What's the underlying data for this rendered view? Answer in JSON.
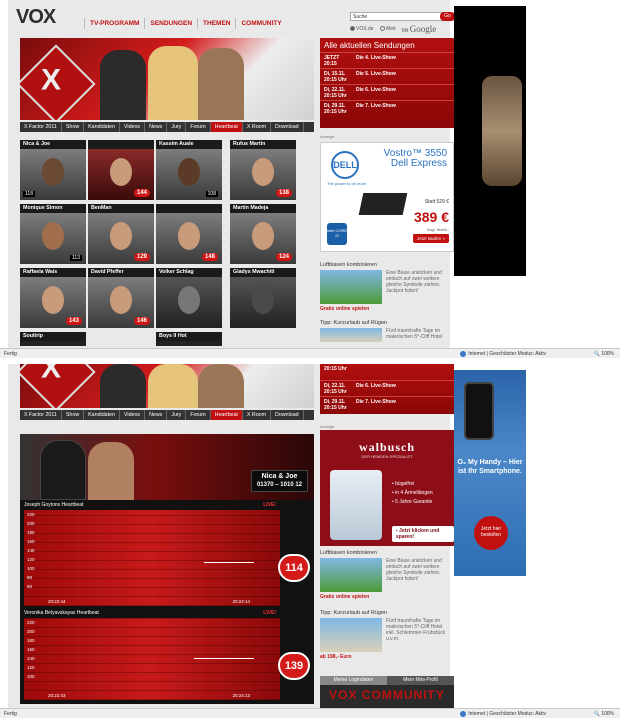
{
  "shot1": {
    "logo": "VOX",
    "mainnav": [
      "TV-PROGRAMM",
      "SENDUNGEN",
      "THEMEN",
      "COMMUNITY"
    ],
    "search": {
      "value": "Suche",
      "button": "Go",
      "opt1": "VOX.de",
      "opt2": "Web",
      "mit": "Mit",
      "google": "Google"
    },
    "subnav": [
      "X Factor 2011",
      "Show",
      "Kandidaten",
      "Videos",
      "News",
      "Jury",
      "Forum",
      "Heartbeat",
      "X Room",
      "Download"
    ],
    "hero_logo": "X",
    "sendungen": {
      "title": "Alle aktuellen Sendungen",
      "rows": [
        {
          "d": "JETZT",
          "t": "20:15",
          "s": "Die 4. Live-Show"
        },
        {
          "d": "Di, 15.11.",
          "t": "20:15 Uhr",
          "s": "Die 5. Live-Show"
        },
        {
          "d": "Di, 22.11.",
          "t": "20:15 Uhr",
          "s": "Die 6. Live-Show"
        },
        {
          "d": "Di, 29.11.",
          "t": "20:15 Uhr",
          "s": "Die 7. Live-Show"
        }
      ]
    },
    "cards": [
      {
        "name": "Nica & Joe",
        "count": "144",
        "small": "118"
      },
      {
        "name": "Kassim Auale",
        "count": "",
        "small": "108"
      },
      {
        "name": "Rufus Martin",
        "count": "138",
        "small": ""
      },
      {
        "name": "Monique Simon",
        "count": "",
        "small": "113"
      },
      {
        "name": "BenMan",
        "count": "129",
        "small": ""
      },
      {
        "name": "",
        "count": "148",
        "small": ""
      },
      {
        "name": "Martin Madeja",
        "count": "124",
        "small": ""
      },
      {
        "name": "Raffaela Wais",
        "count": "143",
        "small": ""
      },
      {
        "name": "David Pfeffer",
        "count": "146",
        "small": ""
      },
      {
        "name": "Volker Schlag",
        "count": "",
        "small": ""
      },
      {
        "name": "Gladys Mwachiti",
        "count": "",
        "small": ""
      },
      {
        "name": "Soultrip",
        "count": "",
        "small": ""
      },
      {
        "name": "Boys II Hot",
        "count": "",
        "small": ""
      }
    ],
    "dell_ad": {
      "label": "Anzeige",
      "brand": "DELL",
      "tagline": "The power to do more",
      "model": "Vostro™ 3550",
      "edition": "Dell Express",
      "statt": "Statt 529 €",
      "price": "389 €",
      "vat": "Zzgl. MwSt., kostenloser Versand",
      "button": "Jetzt kaufen »",
      "intel": "intel CORE i3"
    },
    "promo1": {
      "title": "Luftblasen kombinieren",
      "text": "Eine Blase anklicken und einfach auf zwei weitere gleiche Symbole ziehen. Jackpot holen!",
      "link": "Gratis online spielen"
    },
    "promo2": {
      "title": "Tipp: Kurzurlaub auf Rügen",
      "text": "Fünf traumhafte Tage im malerischen 5*-Cliff Hotel"
    },
    "status": {
      "left": "Fertig",
      "zone": "Internet | Geschützter Modus: Aktiv",
      "zoom": "100%"
    }
  },
  "shot2": {
    "sendungen_rows": [
      {
        "d": "",
        "t": "20:15 Uhr",
        "s": ""
      },
      {
        "d": "Di, 22.11.",
        "t": "20:15 Uhr",
        "s": "Die 6. Live-Show"
      },
      {
        "d": "Di, 29.11.",
        "t": "20:15 Uhr",
        "s": "Die 7. Live-Show"
      }
    ],
    "heartbeat": {
      "pair": "Nica & Joe",
      "phone": "01370 – 1010 12",
      "graph1": {
        "title": "Joseph Goytons Heartbeat",
        "live": "LIVE!",
        "value": "114",
        "t1": "20:22:44",
        "t2": "20:24:14"
      },
      "graph2": {
        "title": "Veronika Belyavskayas Heartbeat",
        "live": "LIVE!",
        "value": "139",
        "t1": "20:22:43",
        "t2": "20:24:13"
      },
      "yticks": [
        "220",
        "200",
        "180",
        "160",
        "140",
        "120",
        "100",
        "80",
        "60",
        "40"
      ]
    },
    "walbusch": {
      "label": "Anzeige",
      "brand": "walbusch",
      "sub": "DER HEMDEN-SPEZIALIST",
      "features": [
        "• bügelfrei",
        "• in 4 Ärmellängen",
        "• 5 Jahre Garantie"
      ],
      "button": "› Jetzt klicken und sparen!"
    },
    "phone_ad": {
      "text": "O₂ My Handy – Hier ist Ihr Smartphone.",
      "button": "Jetzt hier bestellen"
    },
    "promo1": {
      "title": "Luftblasen kombinieren",
      "text": "Eine Blase anklicken und einfach auf zwei weitere gleiche Symbole ziehen. Jackpot holen!",
      "link": "Gratis online spielen"
    },
    "promo2": {
      "title": "Tipp: Kurzurlaub auf Rügen",
      "text": "Fünf traumhafte Tage im malerischen 5*-Cliff Hotel inkl. Schlemmer-Frühstück u.v.m.",
      "link": "ab 198,- Euro"
    },
    "login": {
      "tab1": "Meine Logindaten",
      "tab2": "Mein Mini-Profil",
      "community": "VOX COMMUNITY"
    },
    "status": {
      "left": "Fertig",
      "zone": "Internet | Geschützter Modus: Aktiv",
      "zoom": "100%"
    }
  }
}
